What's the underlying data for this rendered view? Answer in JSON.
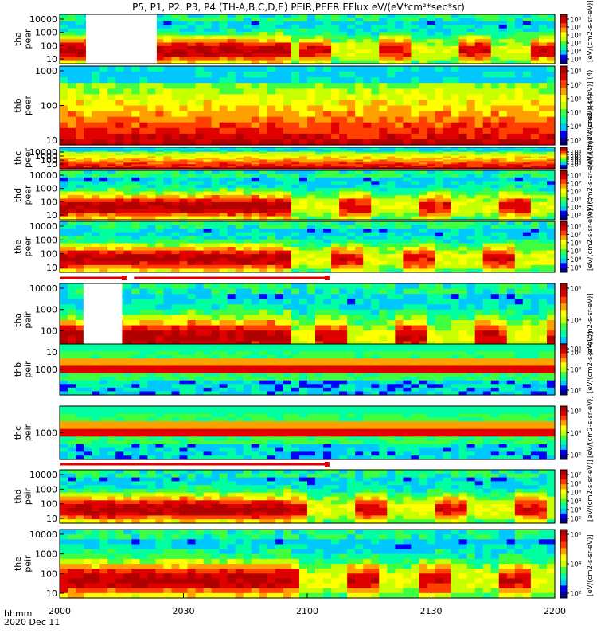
{
  "chart_data": {
    "type": "heatmap",
    "title": "P5, P1, P2, P3, P4 (TH-A,B,C,D,E) PEIR,PEER EFlux eV/(eV*cm²*sec*sr)",
    "x_label_line1": "hhmm",
    "x_label_line2": "2020 Dec 11",
    "x_ticks": [
      "2000",
      "2030",
      "2100",
      "2130",
      "2200"
    ],
    "colorbar_label": "[eV/(cm2-s-sr-eV)]",
    "panels": [
      {
        "probe": "tha",
        "species": "peer",
        "ylabel": [
          "tha",
          "peer"
        ],
        "yticks": [
          "10000",
          "1000",
          "100",
          "10"
        ],
        "gap": [
          0.053,
          0.196
        ],
        "high": "mixed",
        "cbar_ticks": [
          "10⁸",
          "10⁷",
          "10⁶",
          "10⁵",
          "10⁴",
          "10³"
        ],
        "cbar_unit": "(4)"
      },
      {
        "probe": "thb",
        "species": "peer",
        "ylabel": [
          "thb",
          "peer"
        ],
        "yticks": [
          "1000",
          "100",
          "10"
        ],
        "gap": null,
        "high": "steady",
        "cbar_ticks": [
          "10⁸",
          "10⁷",
          "10⁶",
          "10⁵",
          "10⁴",
          "10³"
        ],
        "cbar_unit": "(4)"
      },
      {
        "probe": "thc",
        "species": "peer",
        "ylabel": [
          "thc",
          "peer"
        ],
        "yticks": [
          "10000",
          "1000",
          "100",
          "10"
        ],
        "gap": null,
        "high": "steady",
        "cbar_ticks": [
          "10⁸",
          "10⁷",
          "10⁶",
          "10⁵",
          "10⁴",
          "10³"
        ],
        "cbar_unit": "(4)"
      },
      {
        "probe": "thd",
        "species": "peer",
        "ylabel": [
          "thd",
          "peer"
        ],
        "yticks": [
          "10000",
          "1000",
          "100",
          "10"
        ],
        "gap": null,
        "high": "mixed",
        "cbar_ticks": [
          "10⁸",
          "10⁷",
          "10⁶",
          "10⁵",
          "10⁴",
          "10³"
        ],
        "cbar_unit": "(4)"
      },
      {
        "probe": "the",
        "species": "peer",
        "ylabel": [
          "the",
          "peer"
        ],
        "yticks": [
          "10000",
          "1000",
          "100",
          "10"
        ],
        "gap": null,
        "high": "mixed",
        "cbar_ticks": [
          "10⁸",
          "10⁷",
          "10⁶",
          "10⁵",
          "10⁴",
          "10³"
        ],
        "cbar_unit": "(4)"
      },
      {
        "probe": "tha",
        "species": "peir",
        "ylabel": [
          "tha",
          "peir"
        ],
        "yticks": [
          "10000",
          "1000",
          "100",
          "10"
        ],
        "gap": [
          0.048,
          0.126
        ],
        "high": "mixed",
        "cbar_ticks": [
          "10⁶",
          "10⁴",
          "10²"
        ],
        "cbar_unit": ""
      },
      {
        "probe": "thb",
        "species": "peir",
        "ylabel": [
          "thb",
          "peir"
        ],
        "yticks": [
          "1000"
        ],
        "gap": null,
        "high": "bands",
        "cbar_ticks": [
          "10⁶",
          "10⁴",
          "10²"
        ],
        "cbar_unit": ""
      },
      {
        "probe": "thc",
        "species": "peir",
        "ylabel": [
          "thc",
          "peir"
        ],
        "yticks": [
          "1000"
        ],
        "gap": null,
        "high": "bands",
        "cbar_ticks": [
          "10⁶",
          "10⁴",
          "10²"
        ],
        "cbar_unit": ""
      },
      {
        "probe": "thd",
        "species": "peir",
        "ylabel": [
          "thd",
          "peir"
        ],
        "yticks": [
          "10000",
          "1000",
          "100",
          "10"
        ],
        "gap": null,
        "high": "mixed",
        "cbar_ticks": [
          "10⁷",
          "10⁶",
          "10⁵",
          "10⁴",
          "10³",
          "10²"
        ],
        "cbar_unit": ""
      },
      {
        "probe": "the",
        "species": "peir",
        "ylabel": [
          "the",
          "peir"
        ],
        "yticks": [
          "10000",
          "1000",
          "100",
          "10"
        ],
        "gap": null,
        "high": "mixed",
        "cbar_ticks": [
          "10⁶",
          "10⁴",
          "10²"
        ],
        "cbar_unit": ""
      }
    ],
    "mode_bars": [
      {
        "after_panel": 4,
        "segments": [
          [
            0.0,
            0.13
          ],
          [
            0.15,
            0.54
          ]
        ]
      },
      {
        "after_panel": 7,
        "segments": [
          [
            0.0,
            0.54
          ]
        ]
      }
    ],
    "colorscale": [
      "#00008b",
      "#0000ff",
      "#00c8ff",
      "#00ffa0",
      "#40ff40",
      "#c8ff00",
      "#ffff00",
      "#ffa000",
      "#ff4000",
      "#e00000",
      "#b00000"
    ]
  }
}
